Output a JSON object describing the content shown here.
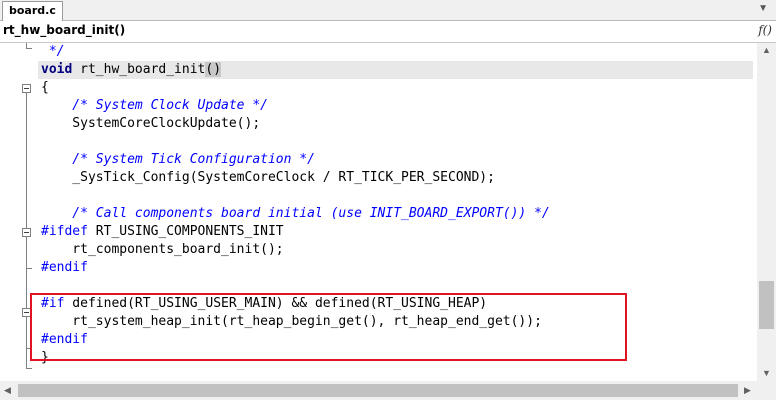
{
  "tab": {
    "label": "board.c"
  },
  "function_bar": {
    "name": "rt_hw_board_init()",
    "icon": "function-icon",
    "icon_glyph": "f()"
  },
  "code_lines": [
    {
      "text": " */",
      "type": "comment"
    },
    {
      "kw": "void",
      "rest": " rt_hw_board_init",
      "paren": "()"
    },
    {
      "text": "{"
    },
    {
      "text": "    /* System Clock Update */",
      "type": "comment"
    },
    {
      "text": "    SystemCoreClockUpdate();"
    },
    {
      "text": ""
    },
    {
      "text": "    /* System Tick Configuration */",
      "type": "comment"
    },
    {
      "text": "    _SysTick_Config(SystemCoreClock / RT_TICK_PER_SECOND);"
    },
    {
      "text": ""
    },
    {
      "text": "    /* Call components board initial (use INIT_BOARD_EXPORT()) */",
      "type": "comment"
    },
    {
      "pp": "#ifdef",
      "rest": " RT_USING_COMPONENTS_INIT"
    },
    {
      "text": "    rt_components_board_init();"
    },
    {
      "pp": "#endif",
      "rest": ""
    },
    {
      "text": ""
    },
    {
      "pp": "#if",
      "rest": " defined(RT_USING_USER_MAIN) && defined(RT_USING_HEAP)"
    },
    {
      "text": "    rt_system_heap_init(rt_heap_begin_get(), rt_heap_end_get());"
    },
    {
      "pp": "#endif",
      "rest": ""
    },
    {
      "text": "}"
    }
  ],
  "colors": {
    "keyword": "#000080",
    "comment": "#0000ff",
    "preprocessor": "#0000ff",
    "highlight_box": "#e0141f"
  }
}
